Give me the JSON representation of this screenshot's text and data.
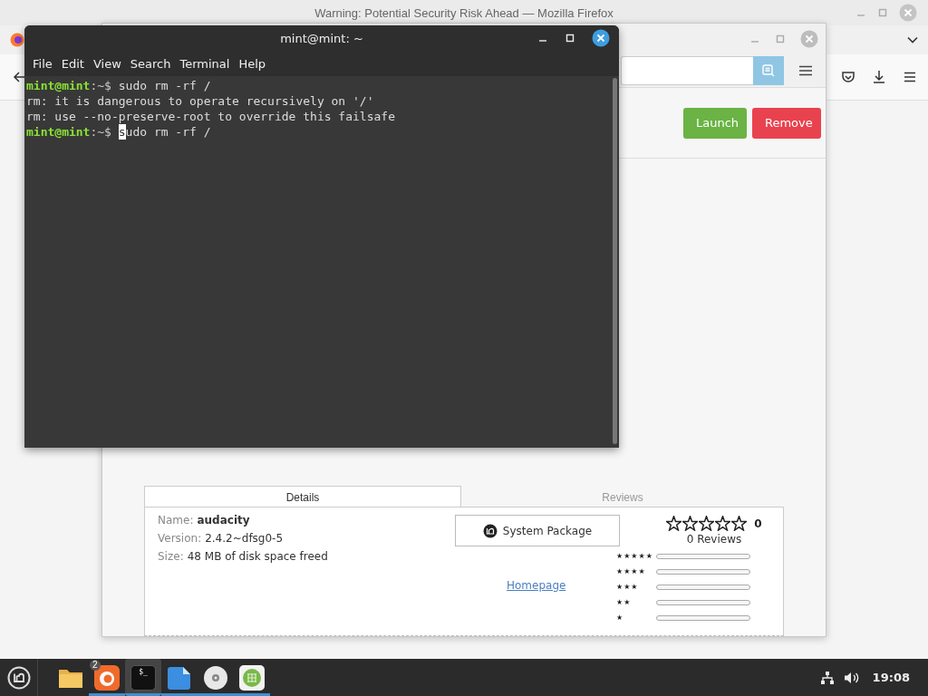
{
  "firefox": {
    "title": "Warning: Potential Security Risk Ahead — Mozilla Firefox"
  },
  "software_manager": {
    "actions": [
      {
        "label": "Launch",
        "kind": "launch"
      },
      {
        "label": "Remove",
        "kind": "remove"
      }
    ],
    "tabs": [
      {
        "label": "Details",
        "selected": true
      },
      {
        "label": "Reviews",
        "selected": false
      }
    ],
    "details": [
      {
        "label": "Name:",
        "value": "audacity",
        "bold": true
      },
      {
        "label": "Version:",
        "value": "2.4.2~dfsg0-5",
        "bold": false
      },
      {
        "label": "Size:",
        "value": "48 MB of disk space freed",
        "bold": false
      }
    ],
    "source": "System Package",
    "homepage": "Homepage",
    "rating": {
      "stars": 0,
      "score": "0",
      "reviews": "0 Reviews",
      "histogram": [
        {
          "label": "★★★★★",
          "level": 0
        },
        {
          "label": "★★★★",
          "level": 0
        },
        {
          "label": "★★★",
          "level": 0
        },
        {
          "label": "★★",
          "level": 0
        },
        {
          "label": "★",
          "level": 0
        }
      ]
    }
  },
  "terminal": {
    "title": "mint@mint: ~",
    "menu": [
      "File",
      "Edit",
      "View",
      "Search",
      "Terminal",
      "Help"
    ],
    "lines": [
      {
        "kind": "prompt",
        "user": "mint@mint",
        "path": ":~$",
        "command": "sudo rm -rf /",
        "cursor": false
      },
      {
        "kind": "output",
        "text": "rm: it is dangerous to operate recursively on '/'"
      },
      {
        "kind": "output",
        "text": "rm: use --no-preserve-root to override this failsafe"
      },
      {
        "kind": "prompt",
        "user": "mint@mint",
        "path": ":~$",
        "command": "sudo rm -rf /",
        "cursor": true
      }
    ]
  },
  "taskbar": {
    "launchers": [
      {
        "kind": "folder",
        "running": false,
        "active": false
      },
      {
        "kind": "firefox",
        "badge": "2",
        "running": true,
        "active": false
      },
      {
        "kind": "terminal",
        "label": "$_",
        "running": true,
        "active": true
      },
      {
        "kind": "document",
        "running": true,
        "active": false
      },
      {
        "kind": "disc",
        "running": true,
        "active": false
      },
      {
        "kind": "grid",
        "running": true,
        "active": false
      }
    ],
    "clock": "19:08"
  }
}
